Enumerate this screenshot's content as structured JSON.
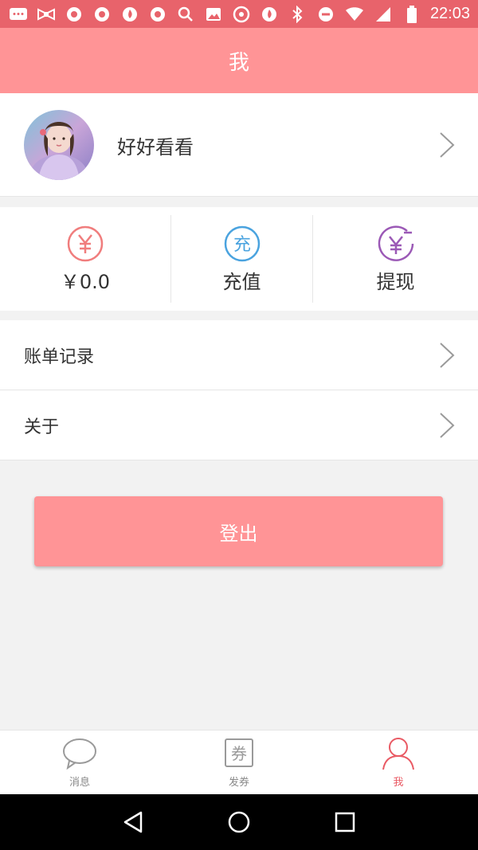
{
  "status": {
    "time": "22:03"
  },
  "header": {
    "title": "我"
  },
  "profile": {
    "name": "好好看看"
  },
  "wallet": {
    "balance": "￥0.0",
    "recharge": "充值",
    "withdraw": "提现"
  },
  "menu": {
    "items": [
      {
        "label": "账单记录"
      },
      {
        "label": "关于"
      }
    ]
  },
  "logout": {
    "label": "登出"
  },
  "tabs": [
    {
      "label": "消息",
      "icon": "chat-bubble-icon"
    },
    {
      "label": "发券",
      "icon": "coupon-icon"
    },
    {
      "label": "我",
      "icon": "person-icon",
      "active": true
    }
  ],
  "colors": {
    "primary": "#ff9496",
    "statusbar": "#e8636b",
    "active_tab": "#e95a64",
    "purple": "#9b59b6",
    "blue": "#4aa3df",
    "coral": "#f07d7d"
  }
}
